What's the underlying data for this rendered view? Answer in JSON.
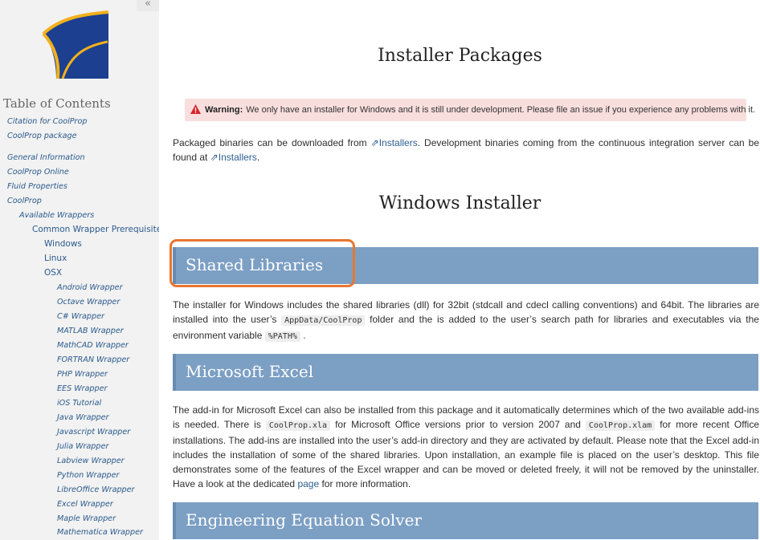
{
  "sidebar": {
    "collapse_label": "«",
    "toc_title": "Table of Contents",
    "items": [
      {
        "label": "Citation for CoolProp",
        "top": 0
      },
      {
        "label": "CoolProp package"
      },
      {
        "label": "General Information"
      },
      {
        "label": "CoolProp Online"
      },
      {
        "label": "Fluid Properties"
      },
      {
        "label": "CoolProp"
      },
      {
        "label": "Available Wrappers"
      },
      {
        "label": "Common Wrapper Prerequisites"
      },
      {
        "label": "Windows"
      },
      {
        "label": "Linux"
      },
      {
        "label": "OSX"
      },
      {
        "label": "Android Wrapper"
      },
      {
        "label": "Octave Wrapper"
      },
      {
        "label": "C# Wrapper"
      },
      {
        "label": "MATLAB Wrapper"
      },
      {
        "label": "MathCAD Wrapper"
      },
      {
        "label": "FORTRAN Wrapper"
      },
      {
        "label": "PHP Wrapper"
      },
      {
        "label": "EES Wrapper"
      },
      {
        "label": "iOS Tutorial"
      },
      {
        "label": "Java Wrapper"
      },
      {
        "label": "Javascript Wrapper"
      },
      {
        "label": "Julia Wrapper"
      },
      {
        "label": "Labview Wrapper"
      },
      {
        "label": "Python Wrapper"
      },
      {
        "label": "LibreOffice Wrapper"
      },
      {
        "label": "Excel Wrapper"
      },
      {
        "label": "Maple Wrapper"
      },
      {
        "label": "Mathematica Wrapper"
      }
    ]
  },
  "main": {
    "page_title": "Installer Packages",
    "warning": {
      "icon": "warning-triangle-icon",
      "label": "Warning:",
      "text": "We only have an installer for Windows and it is still under development. Please file an issue if you experience any problems with it."
    },
    "intro": {
      "t1": "Packaged binaries can be downloaded from ",
      "link1": "Installers",
      "t2": ". Development binaries coming from the continuous integration server can be found at ",
      "link2": "Installers",
      "t3": "."
    },
    "section_title": "Windows Installer",
    "shared": {
      "title": "Shared Libraries",
      "t1": "The installer for Windows includes the shared libraries (dll) for 32bit (stdcall and cdecl calling conventions) and 64bit. The libraries are installed into the user’s ",
      "code1": "AppData/CoolProp",
      "t2": " folder and the is added to the user’s search path for libraries and executables via the environment variable ",
      "code2": "%PATH%",
      "t3": " ."
    },
    "excel": {
      "title": "Microsoft Excel",
      "t1": "The add-in for Microsoft Excel can also be installed from this package and it automatically determines which of the two available add-ins is needed. There is ",
      "code1": "CoolProp.xla",
      "t2": " for Microsoft Office versions prior to version 2007 and ",
      "code2": "CoolProp.xlam",
      "t3": " for more recent Office installations. The add-ins are installed into the user’s add-in directory and they are activated by default. Please note that the Excel add-in includes the installation of some of the shared libraries. Upon installation, an example file is placed on the user’s desktop. This file demonstrates some of the features of the Excel wrapper and can be moved or deleted freely, it will not be removed by the uninstaller. Have a look at the dedicated ",
      "link": "page",
      "t4": " for more information."
    },
    "ees": {
      "title": "Engineering Equation Solver"
    }
  },
  "colors": {
    "banner": "#7c9fc4",
    "warning_bg": "#f9dede",
    "highlight": "#e8762f",
    "link": "#2d5f91"
  }
}
